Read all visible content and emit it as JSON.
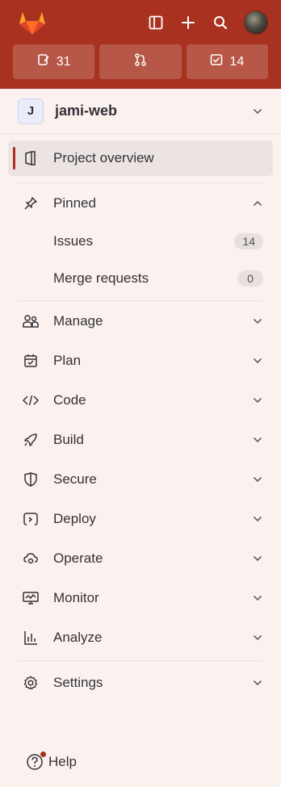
{
  "topbar": {
    "counters": [
      {
        "icon": "issues-icon",
        "count": "31"
      },
      {
        "icon": "merge-request-icon",
        "count": ""
      },
      {
        "icon": "todo-icon",
        "count": "14"
      }
    ]
  },
  "project": {
    "badge": "J",
    "name": "jami-web"
  },
  "nav": {
    "overview": "Project overview",
    "pinned": {
      "label": "Pinned",
      "items": [
        {
          "label": "Issues",
          "count": "14"
        },
        {
          "label": "Merge requests",
          "count": "0"
        }
      ]
    },
    "sections": [
      {
        "label": "Manage",
        "icon": "manage-icon"
      },
      {
        "label": "Plan",
        "icon": "plan-icon"
      },
      {
        "label": "Code",
        "icon": "code-icon"
      },
      {
        "label": "Build",
        "icon": "build-icon"
      },
      {
        "label": "Secure",
        "icon": "shield-icon"
      },
      {
        "label": "Deploy",
        "icon": "deploy-icon"
      },
      {
        "label": "Operate",
        "icon": "operate-icon"
      },
      {
        "label": "Monitor",
        "icon": "monitor-icon"
      },
      {
        "label": "Analyze",
        "icon": "analyze-icon"
      }
    ],
    "settings": "Settings"
  },
  "footer": {
    "help": "Help"
  },
  "colors": {
    "brand": "#a8321f",
    "sidebar_bg": "#fbf2ef"
  }
}
